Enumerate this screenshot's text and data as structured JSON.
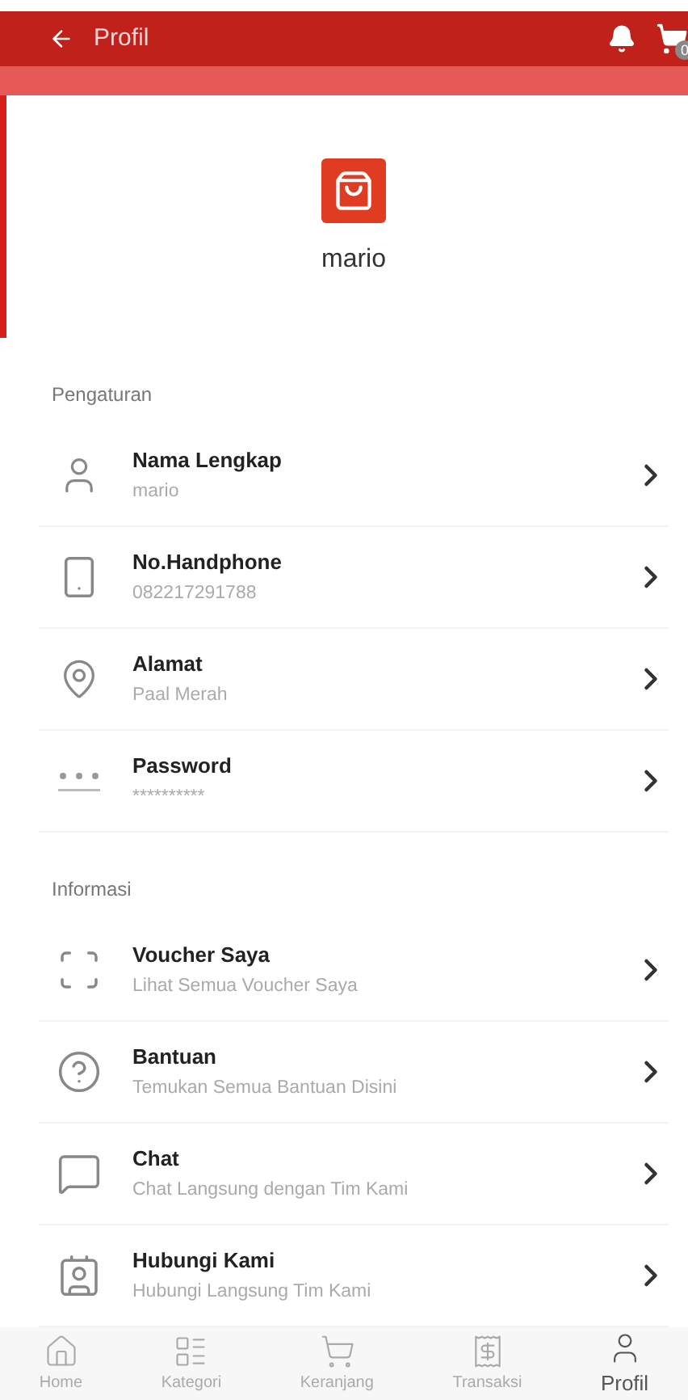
{
  "header": {
    "title": "Profil",
    "cart_badge": "0"
  },
  "profile": {
    "name": "mario"
  },
  "sections": [
    {
      "title": "Pengaturan",
      "items": [
        {
          "kind": "user",
          "label": "Nama Lengkap",
          "value": "mario"
        },
        {
          "kind": "phone",
          "label": "No.Handphone",
          "value": "082217291788"
        },
        {
          "kind": "location",
          "label": "Alamat",
          "value": "Paal Merah"
        },
        {
          "kind": "password",
          "label": "Password",
          "value": "**********"
        }
      ]
    },
    {
      "title": "Informasi",
      "items": [
        {
          "kind": "voucher",
          "label": "Voucher Saya",
          "value": "Lihat Semua Voucher Saya"
        },
        {
          "kind": "help",
          "label": "Bantuan",
          "value": "Temukan Semua Bantuan Disini"
        },
        {
          "kind": "chat",
          "label": "Chat",
          "value": "Chat Langsung dengan Tim Kami"
        },
        {
          "kind": "contact",
          "label": "Hubungi Kami",
          "value": "Hubungi Langsung Tim Kami"
        }
      ]
    }
  ],
  "bottom_nav": [
    {
      "kind": "home",
      "label": "Home",
      "selected": false
    },
    {
      "kind": "category",
      "label": "Kategori",
      "selected": false
    },
    {
      "kind": "cart",
      "label": "Keranjang",
      "selected": false
    },
    {
      "kind": "transaction",
      "label": "Transaksi",
      "selected": false
    },
    {
      "kind": "profile",
      "label": "Profil",
      "selected": true
    }
  ]
}
